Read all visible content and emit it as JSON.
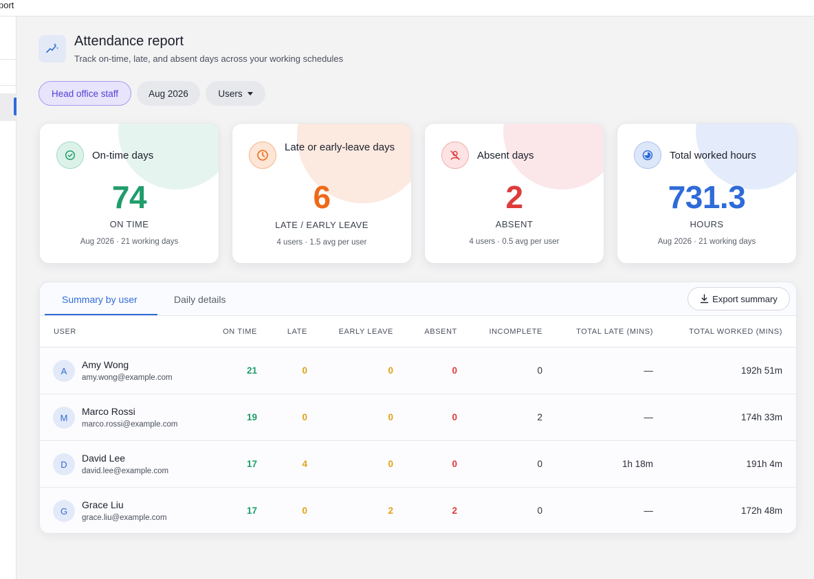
{
  "window": {
    "title_fragment": "port"
  },
  "header": {
    "title": "Attendance report",
    "subtitle": "Track on-time, late, and absent days across your working schedules",
    "icon": "sparkle-chart-icon"
  },
  "filters": {
    "group": "Head office staff",
    "period": "Aug 2026",
    "users": "Users"
  },
  "cards": [
    {
      "title": "On-time days",
      "value": "74",
      "label": "ON TIME",
      "foot": "Aug 2026 · 21 working days",
      "color": "#1f9d6a",
      "icon": "check-circle-icon"
    },
    {
      "title": "Late or early-leave days",
      "value": "6",
      "label": "LATE / EARLY LEAVE",
      "foot": "4 users · 1.5 avg per user",
      "color": "#ee6a19",
      "icon": "clock-icon"
    },
    {
      "title": "Absent days",
      "value": "2",
      "label": "ABSENT",
      "foot": "4 users · 0.5 avg per user",
      "color": "#dd3b3b",
      "icon": "user-off-icon"
    },
    {
      "title": "Total worked hours",
      "value": "731.3",
      "label": "HOURS",
      "foot": "Aug 2026 · 21 working days",
      "color": "#2f6bd8",
      "icon": "pie-clock-icon"
    }
  ],
  "tabs": {
    "summary": "Summary by user",
    "daily": "Daily details"
  },
  "export_label": "Export summary",
  "columns": {
    "user": "USER",
    "on_time": "ON TIME",
    "late": "LATE",
    "early_leave": "EARLY LEAVE",
    "absent": "ABSENT",
    "incomplete": "INCOMPLETE",
    "total_late": "TOTAL LATE (MINS)",
    "total_worked": "TOTAL WORKED (MINS)"
  },
  "rows": [
    {
      "initial": "A",
      "name": "Amy Wong",
      "email": "amy.wong@example.com",
      "on_time": "21",
      "late": "0",
      "early_leave": "0",
      "absent": "0",
      "incomplete": "0",
      "total_late": "—",
      "total_worked": "192h 51m"
    },
    {
      "initial": "M",
      "name": "Marco Rossi",
      "email": "marco.rossi@example.com",
      "on_time": "19",
      "late": "0",
      "early_leave": "0",
      "absent": "0",
      "incomplete": "2",
      "total_late": "—",
      "total_worked": "174h 33m"
    },
    {
      "initial": "D",
      "name": "David Lee",
      "email": "david.lee@example.com",
      "on_time": "17",
      "late": "4",
      "early_leave": "0",
      "absent": "0",
      "incomplete": "0",
      "total_late": "1h 18m",
      "total_worked": "191h 4m"
    },
    {
      "initial": "G",
      "name": "Grace Liu",
      "email": "grace.liu@example.com",
      "on_time": "17",
      "late": "0",
      "early_leave": "2",
      "absent": "2",
      "incomplete": "0",
      "total_late": "—",
      "total_worked": "172h 48m"
    }
  ]
}
